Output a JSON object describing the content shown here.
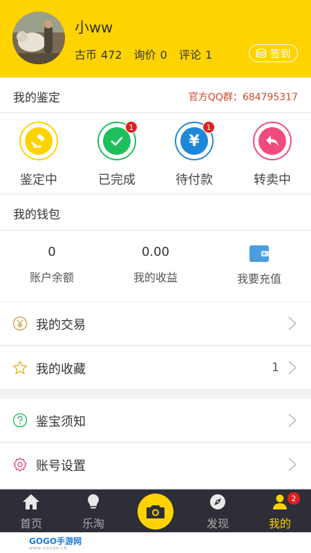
{
  "profile": {
    "username": "小ww",
    "stat_coins_label": "古币",
    "stat_coins_value": "472",
    "stat_inquiry_label": "询价",
    "stat_inquiry_value": "0",
    "stat_comments_label": "评论",
    "stat_comments_value": "1",
    "signin_label": "签到"
  },
  "appraisal": {
    "title": "我的鉴定",
    "qq_group": "官方QQ群：684795317",
    "items": [
      {
        "label": "鉴定中",
        "icon": "gavel-icon",
        "color": "#ffd300",
        "badge": ""
      },
      {
        "label": "已完成",
        "icon": "check-icon",
        "color": "#1fbf5b",
        "badge": "1"
      },
      {
        "label": "待付款",
        "icon": "yen-icon",
        "color": "#1e88d8",
        "badge": "1"
      },
      {
        "label": "转卖中",
        "icon": "return-arrow-icon",
        "color": "#ef4b7f",
        "badge": ""
      }
    ]
  },
  "wallet": {
    "title": "我的钱包",
    "balance_value": "0",
    "balance_label": "账户余额",
    "earnings_value": "0.00",
    "earnings_label": "我的收益",
    "recharge_label": "我要充值"
  },
  "menu": {
    "trades": {
      "label": "我的交易",
      "icon": "yen-circle-icon"
    },
    "favorites": {
      "label": "我的收藏",
      "icon": "star-icon",
      "count": "1"
    },
    "guide": {
      "label": "鉴宝须知",
      "icon": "question-circle-icon"
    },
    "settings": {
      "label": "账号设置",
      "icon": "gear-icon"
    }
  },
  "tabbar": {
    "home": "首页",
    "shop": "乐淘",
    "discover": "发现",
    "mine": "我的",
    "mine_badge": "2"
  },
  "colors": {
    "accent": "#ffd300",
    "tabbar_bg": "#2e2e38",
    "badge": "#e02020",
    "qq_text": "#d0452a"
  },
  "watermark": {
    "text": "GOGO手游网",
    "url": "WWW.GOGO8.CN"
  }
}
